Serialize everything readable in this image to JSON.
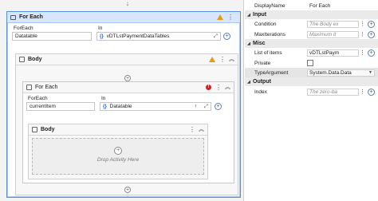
{
  "outer_foreach": {
    "title": "For Each",
    "foreach_label": "ForEach",
    "in_label": "In",
    "foreach_value": "Datatable",
    "in_value": "vDTLstPaymentDataTables",
    "fx": "{}",
    "more": "⋮"
  },
  "outer_body": {
    "title": "Body"
  },
  "inner_foreach": {
    "title": "For Each",
    "error_badge": "!",
    "foreach_label": "ForEach",
    "in_label": "In",
    "foreach_value": "currentItem",
    "in_value": "Datatable",
    "fx": "{}"
  },
  "inner_body": {
    "title": "Body",
    "drop_text": "Drop Activity Here"
  },
  "props": {
    "display_name_label": "DisplayName",
    "display_name_value": "For Each",
    "input_category": "Input",
    "condition_label": "Condition",
    "condition_placeholder": "The Body ex",
    "maxiterations_label": "MaxIterations",
    "maxiterations_placeholder": "Maximum it",
    "misc_category": "Misc",
    "list_items_label": "List of items",
    "list_items_value": "vDTLstPaym",
    "private_label": "Private",
    "private_checked": false,
    "type_argument_label": "TypeArgument",
    "type_argument_value": "System.Data.Data",
    "output_category": "Output",
    "index_label": "Index",
    "index_placeholder": "The zero-ba"
  },
  "icons": {
    "warning": "warning-icon",
    "error": "error-icon",
    "expand": "expand-icon",
    "add": "add-variable-icon",
    "collapse": "chevron-up-icon"
  },
  "colors": {
    "selection_border": "#5b8fd6",
    "warning": "#e39a1b",
    "error": "#c62828"
  }
}
